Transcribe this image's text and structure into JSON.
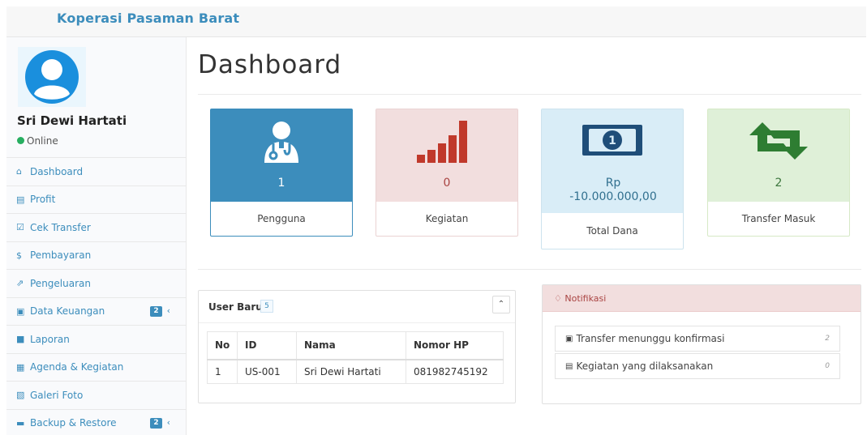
{
  "header": {
    "brand": "Koperasi Pasaman Barat"
  },
  "user": {
    "name": "Sri Dewi Hartati",
    "status": "Online"
  },
  "menu": [
    {
      "label": "Dashboard",
      "icon": "home-icon",
      "glyph": "⌂"
    },
    {
      "label": "Profit",
      "icon": "bar-chart-icon",
      "glyph": "▤"
    },
    {
      "label": "Cek Transfer",
      "icon": "check-square-icon",
      "glyph": "☑"
    },
    {
      "label": "Pembayaran",
      "icon": "dollar-icon",
      "glyph": "$"
    },
    {
      "label": "Pengeluaran",
      "icon": "external-link-icon",
      "glyph": "⇗"
    },
    {
      "label": "Data Keuangan",
      "icon": "money-icon",
      "glyph": "▣",
      "badge": "2"
    },
    {
      "label": "Laporan",
      "icon": "file-icon",
      "glyph": "■"
    },
    {
      "label": "Agenda & Kegiatan",
      "icon": "calendar-icon",
      "glyph": "▦"
    },
    {
      "label": "Galeri Foto",
      "icon": "image-icon",
      "glyph": "▧"
    },
    {
      "label": "Backup & Restore",
      "icon": "database-icon",
      "glyph": "▬",
      "badge": "2"
    }
  ],
  "page": {
    "title": "Dashboard"
  },
  "stats": [
    {
      "value": "1",
      "label": "Pengguna",
      "icon": "user-doctor-icon",
      "color": "#3c8dbc"
    },
    {
      "value": "0",
      "label": "Kegiatan",
      "icon": "signal-icon",
      "color": "#f2dede"
    },
    {
      "value": "Rp -10.000.000,00",
      "label": "Total Dana",
      "icon": "money-bill-icon",
      "color": "#d9edf7"
    },
    {
      "value": "2",
      "label": "Transfer Masuk",
      "icon": "retweet-icon",
      "color": "#dff0d8"
    }
  ],
  "user_baru": {
    "title": "User Baru",
    "count": "5",
    "columns": [
      "No",
      "ID",
      "Nama",
      "Nomor HP"
    ],
    "rows": [
      [
        "1",
        "US-001",
        "Sri Dewi Hartati",
        "081982745192"
      ]
    ]
  },
  "notifikasi": {
    "title": "Notifikasi",
    "items": [
      {
        "label": "Transfer menunggu konfirmasi",
        "count": "2",
        "icon": "money-icon"
      },
      {
        "label": "Kegiatan yang dilaksanakan",
        "count": "0",
        "icon": "list-icon"
      }
    ]
  }
}
